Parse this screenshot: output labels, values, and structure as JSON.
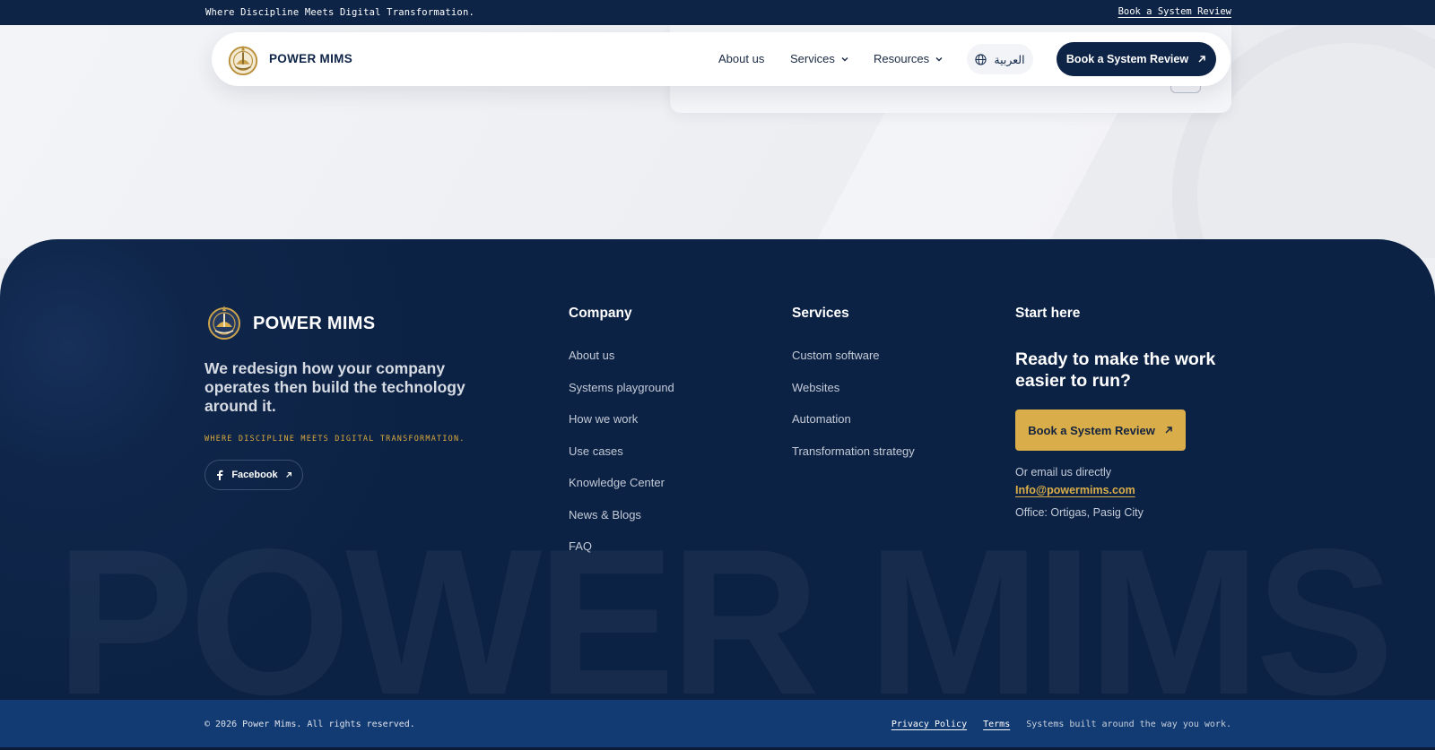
{
  "topbar": {
    "tagline": "Where Discipline Meets Digital Transformation.",
    "link": "Book a System Review"
  },
  "nav": {
    "brand": "POWER MIMS",
    "items": [
      {
        "label": "About us"
      },
      {
        "label": "Services"
      },
      {
        "label": "Resources"
      }
    ],
    "language": "العربية",
    "cta": "Book a System Review"
  },
  "footer": {
    "brand": "POWER MIMS",
    "intro": "We redesign how your company operates then build the technology around it.",
    "tagline": "WHERE DISCIPLINE MEETS DIGITAL TRANSFORMATION.",
    "facebook": "Facebook",
    "watermark": "POWER MIMS",
    "company": {
      "heading": "Company",
      "links": [
        "About us",
        "Systems playground",
        "How we work",
        "Use cases",
        "Knowledge Center",
        "News & Blogs",
        "FAQ"
      ]
    },
    "services": {
      "heading": "Services",
      "links": [
        "Custom software",
        "Websites",
        "Automation",
        "Transformation strategy"
      ]
    },
    "start": {
      "heading": "Start here",
      "question": "Ready to make the work easier to run?",
      "button": "Book a System Review",
      "email_label": "Or email us directly",
      "email": "Info@powermims.com",
      "office": "Office: Ortigas, Pasig City"
    }
  },
  "bottombar": {
    "copyright": "© 2026 Power Mims. All rights reserved.",
    "privacy": "Privacy Policy",
    "terms": "Terms",
    "slogan": "Systems built around the way you work."
  },
  "colors": {
    "navy": "#0e2447",
    "gold": "#d9ae4a",
    "footer_bg": "#0c2244",
    "bottom_bar": "#133b73"
  }
}
